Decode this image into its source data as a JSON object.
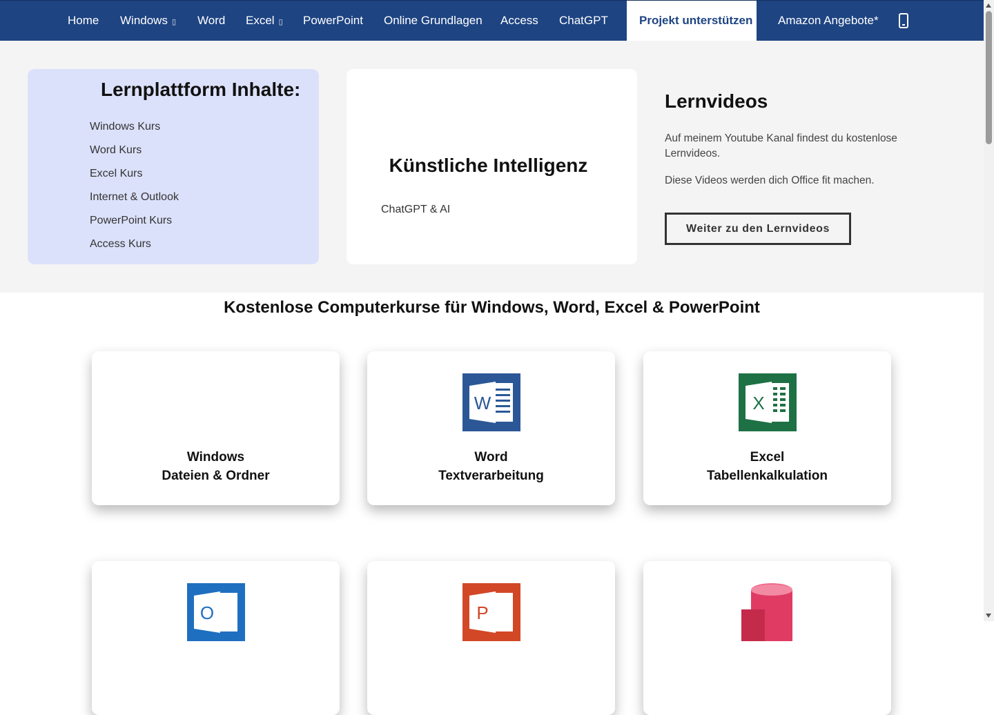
{
  "nav": {
    "items": [
      {
        "label": "Home"
      },
      {
        "label": "Windows",
        "dropdown": true
      },
      {
        "label": "Word"
      },
      {
        "label": "Excel",
        "dropdown": true
      },
      {
        "label": "PowerPoint"
      },
      {
        "label": "Online Grundlagen"
      },
      {
        "label": "Access"
      },
      {
        "label": "ChatGPT"
      },
      {
        "label": "Projekt unterstützen",
        "active": true
      },
      {
        "label": "Amazon Angebote*"
      }
    ],
    "caret_glyph": "▯",
    "search_icon": "search-icon",
    "colors": {
      "background": "#1e4482",
      "active_bg": "#ffffff",
      "active_text": "#1e4482"
    }
  },
  "sidebar_panel": {
    "title": "Lernplattform Inhalte:",
    "links": [
      "Windows Kurs",
      "Word Kurs",
      "Excel Kurs",
      "Internet & Outlook",
      "PowerPoint Kurs",
      "Access Kurs"
    ],
    "color": "#dce1fb"
  },
  "ai_panel": {
    "title": "Künstliche Intelligenz",
    "link": "ChatGPT & AI"
  },
  "videos": {
    "title": "Lernvideos",
    "text1": "Auf meinem Youtube Kanal findest du kostenlose Lernvideos.",
    "text2": "Diese Videos werden dich Office fit machen.",
    "button": "Weiter zu den Lernvideos"
  },
  "main": {
    "title": "Kostenlose Computerkurse für Windows, Word, Excel & PowerPoint",
    "cards": [
      {
        "line1": "Windows",
        "line2": "Dateien & Ordner",
        "icon": "windows-icon"
      },
      {
        "line1": "Word",
        "line2": "Textverarbeitung",
        "icon": "word-icon",
        "color": "#2b5797"
      },
      {
        "line1": "Excel",
        "line2": "Tabellenkalkulation",
        "icon": "excel-icon",
        "color": "#1e7145"
      },
      {
        "line1": "",
        "line2": "",
        "icon": "outlook-icon",
        "color": "#1f6fc1"
      },
      {
        "line1": "",
        "line2": "",
        "icon": "powerpoint-icon",
        "color": "#d24726"
      },
      {
        "line1": "",
        "line2": "",
        "icon": "access-icon",
        "color": "#c42b4b"
      }
    ]
  }
}
